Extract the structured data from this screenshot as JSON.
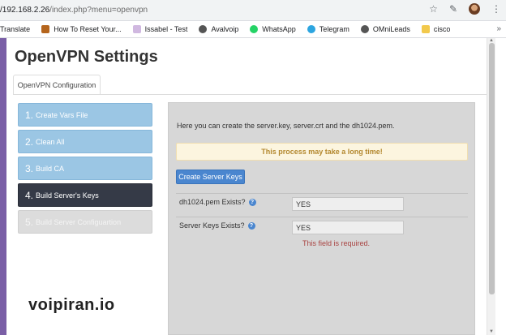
{
  "browser": {
    "url_host": "/192.168.2.26",
    "url_path": "/index.php?menu=openvpn",
    "icons": [
      "star-icon",
      "extension-icon",
      "avatar",
      "menu-icon"
    ]
  },
  "bookmarks": [
    {
      "label": "Translate",
      "icon": "none",
      "color": "#ffffff"
    },
    {
      "label": "How To Reset Your...",
      "icon": "bookmark-icon",
      "color": "#b5651d"
    },
    {
      "label": "Issabel - Test",
      "icon": "issabel-icon",
      "color": "#d0b8e0"
    },
    {
      "label": "Avalvoip",
      "icon": "globe-icon",
      "color": "#555555"
    },
    {
      "label": "WhatsApp",
      "icon": "whatsapp-icon",
      "color": "#25d366"
    },
    {
      "label": "Telegram",
      "icon": "telegram-icon",
      "color": "#2ca5e0"
    },
    {
      "label": "OMniLeads",
      "icon": "globe-icon",
      "color": "#555555"
    },
    {
      "label": "cisco",
      "icon": "folder-icon",
      "color": "#f2c94c"
    }
  ],
  "page": {
    "title": "OpenVPN Settings",
    "tab": "OpenVPN Configuration"
  },
  "steps": [
    {
      "num": "1.",
      "label": "Create Vars File",
      "state": "done"
    },
    {
      "num": "2.",
      "label": "Clean All",
      "state": "done"
    },
    {
      "num": "3.",
      "label": "Build CA",
      "state": "done"
    },
    {
      "num": "4.",
      "label": "Build Server's Keys",
      "state": "active"
    },
    {
      "num": "5.",
      "label": "Build Server Configuartion",
      "state": "disabled"
    }
  ],
  "panel": {
    "intro": "Here you can create the server.key, server.crt and the dh1024.pem.",
    "warning": "This process may take a long time!",
    "button": "Create Server Keys",
    "rows": [
      {
        "label": "dh1024.pem Exists?",
        "value": "YES"
      },
      {
        "label": "Server Keys Exists?",
        "value": "YES"
      }
    ],
    "error": "This field is required."
  },
  "watermark": "voipiran.io",
  "colors": {
    "step_done": "#9bc6e4",
    "step_active": "#353a47",
    "step_disabled": "#dcdcdc",
    "button": "#4a86cf",
    "warning_bg": "#fcf5df",
    "error": "#a94442"
  }
}
